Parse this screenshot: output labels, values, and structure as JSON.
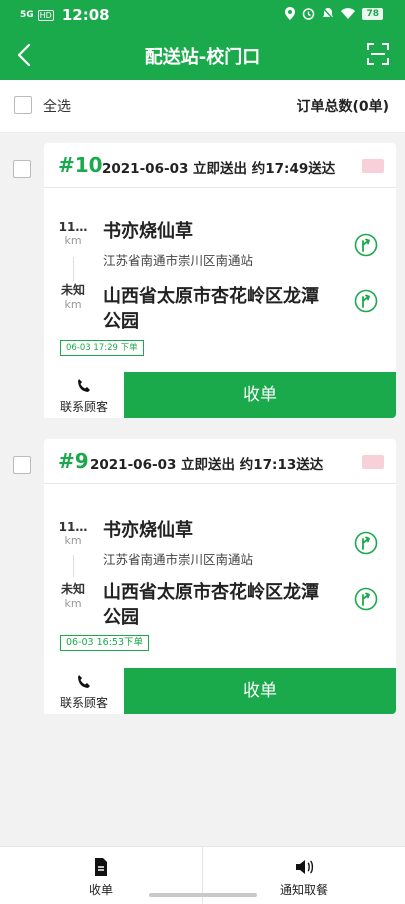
{
  "status_bar": {
    "network": "5G",
    "hd": "HD",
    "time": "12:08",
    "battery": "78"
  },
  "header": {
    "title": "配送站-校门口"
  },
  "select_bar": {
    "select_all_label": "全选",
    "total_label": "订单总数(0单)"
  },
  "orders": [
    {
      "number": "#10",
      "info": "2021-06-03 立即送出 约17:49送达",
      "pickup": {
        "distance": "11…",
        "unit": "km",
        "name": "书亦烧仙草",
        "address": "江苏省南通市崇川区南通站"
      },
      "dropoff": {
        "distance": "未知",
        "unit": "km",
        "name_line1": "山西省太原市杏花岭区龙潭",
        "name_line2": "公园"
      },
      "time_tag": "06-03 17:29 下单",
      "contact_label": "联系顾客",
      "receive_label": "收单"
    },
    {
      "number": "#9",
      "info": "2021-06-03 立即送出 约17:13送达",
      "pickup": {
        "distance": "11…",
        "unit": "km",
        "name": "书亦烧仙草",
        "address": "江苏省南通市崇川区南通站"
      },
      "dropoff": {
        "distance": "未知",
        "unit": "km",
        "name_line1": "山西省太原市杏花岭区龙潭",
        "name_line2": "公园"
      },
      "time_tag": "06-03 16:53下单",
      "contact_label": "联系顾客",
      "receive_label": "收单"
    }
  ],
  "tab_bar": {
    "left_label": "收单",
    "right_label": "通知取餐"
  },
  "colors": {
    "brand": "#1aaa4c",
    "background": "#f2f2f2",
    "badge": "#f7d0da"
  }
}
